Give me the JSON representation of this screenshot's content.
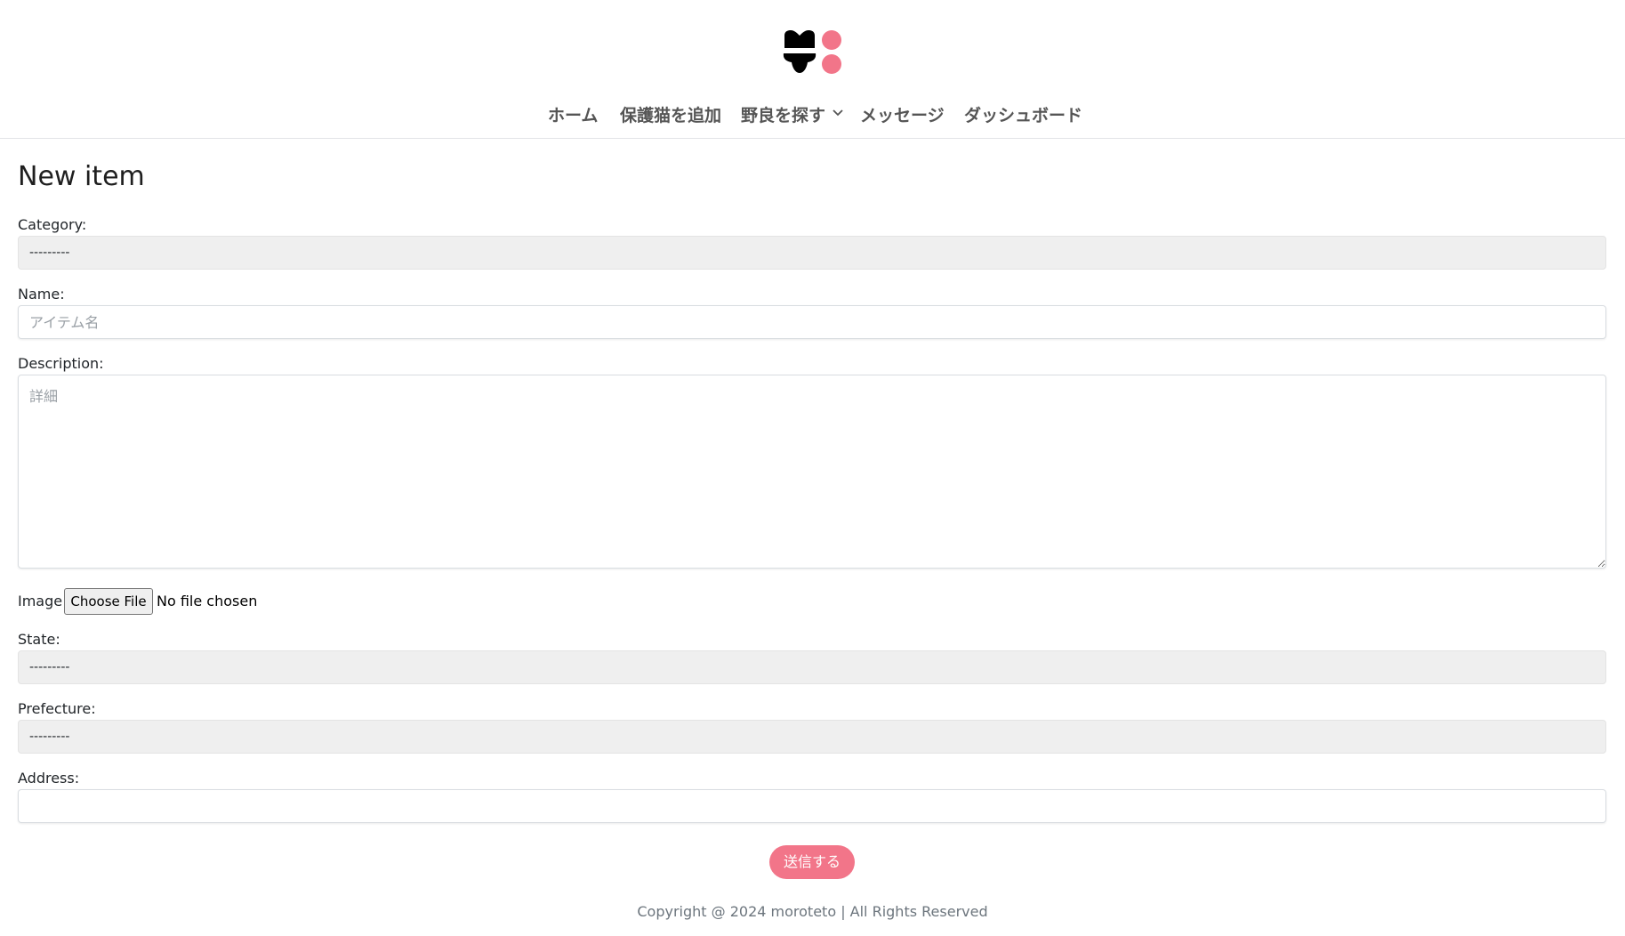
{
  "header": {
    "nav": [
      {
        "label": "ホーム"
      },
      {
        "label": "保護猫を追加"
      },
      {
        "label": "野良を探す"
      },
      {
        "label": "メッセージ"
      },
      {
        "label": "ダッシュボード"
      }
    ]
  },
  "icons": {
    "logo": "cat-paw-logo-icon",
    "dropdown": "chevron-down-icon"
  },
  "colors": {
    "accent": "#f27589",
    "logo_dark": "#000000",
    "select_background": "#efefef"
  },
  "page": {
    "title": "New item"
  },
  "form": {
    "category": {
      "label": "Category:",
      "value": "---------"
    },
    "name": {
      "label": "Name:",
      "value": "",
      "placeholder": "アイテム名"
    },
    "description": {
      "label": "Description:",
      "value": "",
      "placeholder": "詳細"
    },
    "image": {
      "label": "Image:",
      "button": "Choose File",
      "status": "No file chosen"
    },
    "state": {
      "label": "State:",
      "value": "---------"
    },
    "prefecture": {
      "label": "Prefecture:",
      "value": "---------"
    },
    "address": {
      "label": "Address:",
      "value": "",
      "placeholder": ""
    },
    "submit": "送信する"
  },
  "footer": {
    "copyright": "Copyright @ 2024 moroteto | All Rights Reserved"
  }
}
